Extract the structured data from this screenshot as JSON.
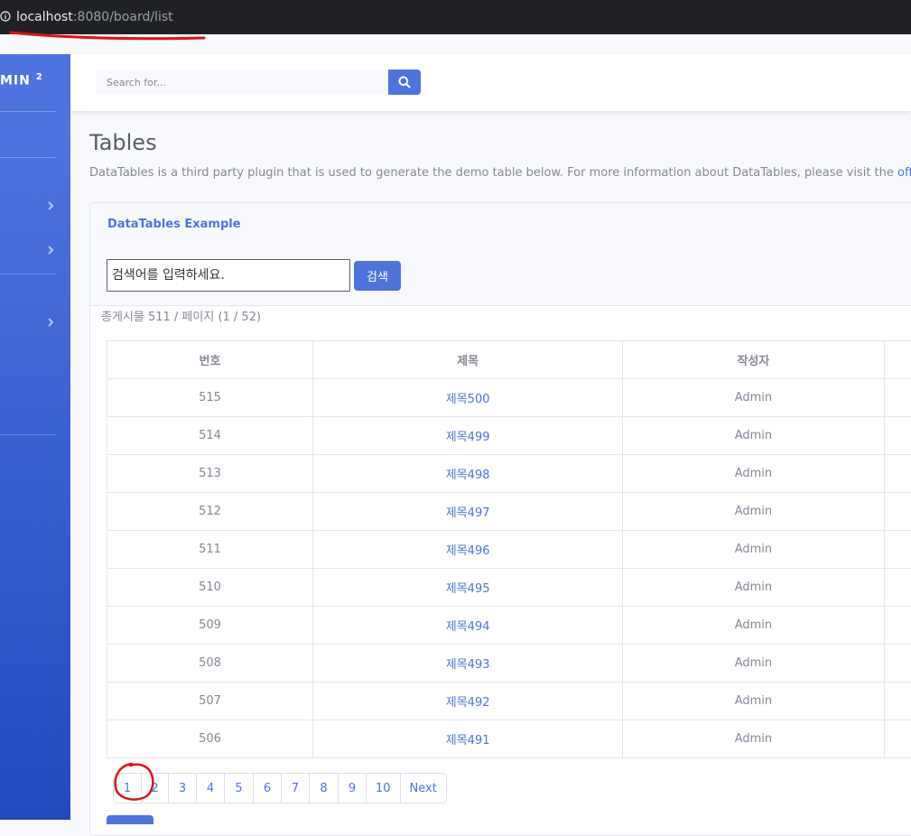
{
  "browser": {
    "url_host": "localhost",
    "url_rest": ":8080/board/list"
  },
  "sidebar": {
    "brand": "MIN",
    "brand_sup": "2"
  },
  "topbar": {
    "search_placeholder": "Search for..."
  },
  "page": {
    "title": "Tables",
    "description": "DataTables is a third party plugin that is used to generate the demo table below. For more information about DataTables, please visit the ",
    "description_link": "offic"
  },
  "card": {
    "header": "DataTables Example",
    "keyword_placeholder": "검색어를 입력하세요.",
    "search_button": "검색",
    "summary": "총게시물 511 / 페이지 (1 / 52)"
  },
  "table": {
    "headers": [
      "번호",
      "제목",
      "작성자"
    ],
    "rows": [
      {
        "no": "515",
        "title": "제목500",
        "writer": "Admin"
      },
      {
        "no": "514",
        "title": "제목499",
        "writer": "Admin"
      },
      {
        "no": "513",
        "title": "제목498",
        "writer": "Admin"
      },
      {
        "no": "512",
        "title": "제목497",
        "writer": "Admin"
      },
      {
        "no": "511",
        "title": "제목496",
        "writer": "Admin"
      },
      {
        "no": "510",
        "title": "제목495",
        "writer": "Admin"
      },
      {
        "no": "509",
        "title": "제목494",
        "writer": "Admin"
      },
      {
        "no": "508",
        "title": "제목493",
        "writer": "Admin"
      },
      {
        "no": "507",
        "title": "제목492",
        "writer": "Admin"
      },
      {
        "no": "506",
        "title": "제목491",
        "writer": "Admin"
      }
    ]
  },
  "pagination": [
    "1",
    "2",
    "3",
    "4",
    "5",
    "6",
    "7",
    "8",
    "9",
    "10",
    "Next"
  ],
  "colors": {
    "primary": "#4e73df",
    "annotation": "#e0101a",
    "text": "#858796"
  }
}
